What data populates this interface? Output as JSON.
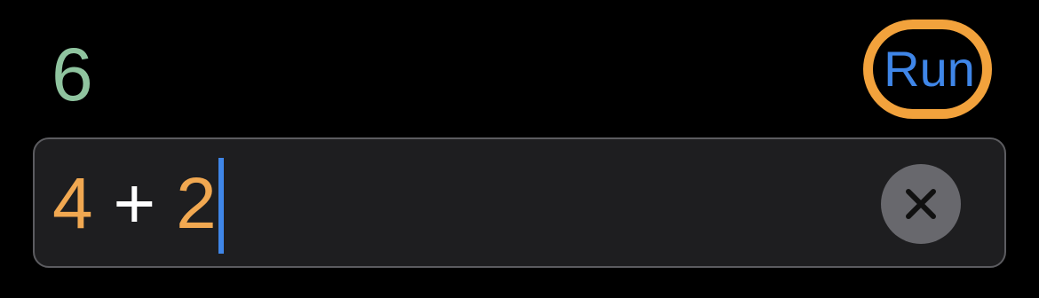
{
  "result": {
    "value": "6",
    "color": "#8fc49f"
  },
  "run_button": {
    "label": "Run",
    "text_color": "#3f86e8",
    "highlight_color": "#f2a23c"
  },
  "input": {
    "tokens": [
      {
        "text": "4",
        "kind": "number"
      },
      {
        "text": " + ",
        "kind": "operator"
      },
      {
        "text": "2",
        "kind": "number"
      }
    ],
    "number_color": "#f1a851",
    "operator_color": "#ffffff",
    "caret_color": "#3f86e8"
  },
  "clear_button": {
    "icon": "close-icon"
  }
}
